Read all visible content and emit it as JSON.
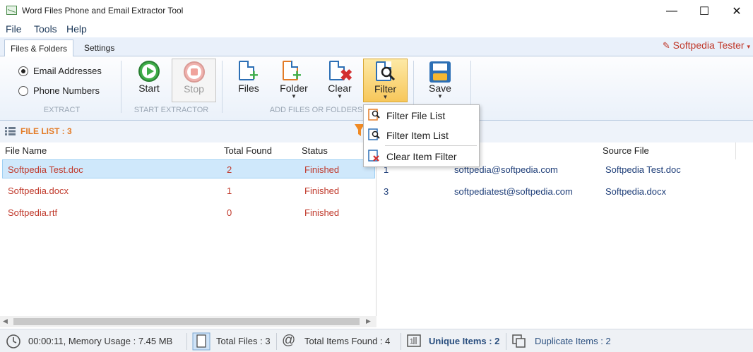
{
  "window": {
    "title": "Word Files Phone and Email Extractor Tool"
  },
  "menu": [
    "File",
    "Tools",
    "Help"
  ],
  "tabs": [
    "Files & Folders",
    "Settings"
  ],
  "user": "Softpedia Tester",
  "ribbon": {
    "radio_email": "Email Addresses",
    "radio_phone": "Phone Numbers",
    "group_extract": "EXTRACT",
    "start": "Start",
    "stop": "Stop",
    "group_start": "START EXTRACTOR",
    "files": "Files",
    "folder": "Folder",
    "clear": "Clear",
    "filter": "Filter",
    "group_add": "ADD FILES OR FOLDERS",
    "save": "Save"
  },
  "file_list": {
    "title": "FILE LIST : 3",
    "columns": [
      "File Name",
      "Total Found",
      "Status"
    ],
    "rows": [
      {
        "name": "Softpedia Test.doc",
        "found": "2",
        "status": "Finished"
      },
      {
        "name": "Softpedia.docx",
        "found": "1",
        "status": "Finished"
      },
      {
        "name": "Softpedia.rtf",
        "found": "0",
        "status": "Finished"
      }
    ]
  },
  "item_list": {
    "columns": [
      "Source File"
    ],
    "rows": [
      {
        "num": "1",
        "item": "softpedia@softpedia.com",
        "source": "Softpedia Test.doc"
      },
      {
        "num": "3",
        "item": "softpediatest@softpedia.com",
        "source": "Softpedia.docx"
      }
    ]
  },
  "filter_menu": [
    "Filter File List",
    "Filter Item List",
    "Clear Item Filter"
  ],
  "status": {
    "time": "00:00:11, Memory Usage : 7.45 MB",
    "total_files": "Total Files : 3",
    "total_items": "Total Items Found : 4",
    "unique": "Unique Items : 2",
    "duplicate": "Duplicate Items : 2"
  },
  "colors": {
    "accent": "#e37b26",
    "ribbon_highlight": "#f7c75b",
    "error_text": "#c0392b"
  }
}
